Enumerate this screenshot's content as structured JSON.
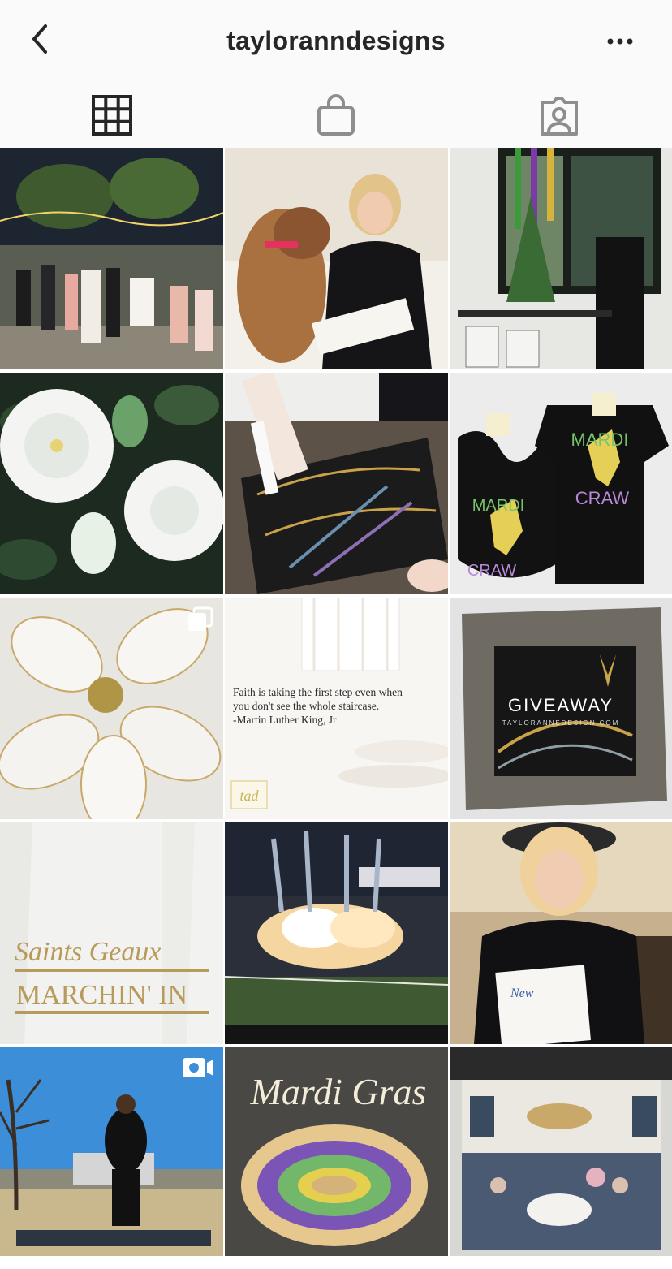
{
  "header": {
    "title": "tayloranndesigns",
    "back_icon": "chevron-left-icon",
    "more_icon": "ellipsis-icon"
  },
  "tabs": [
    {
      "name": "grid",
      "icon": "grid-icon",
      "active": true
    },
    {
      "name": "shop",
      "icon": "shopping-bag-icon",
      "active": false
    },
    {
      "name": "tagged",
      "icon": "tagged-person-icon",
      "active": false
    }
  ],
  "posts": [
    {
      "subject": "wedding painting night courtyard"
    },
    {
      "subject": "woman with boxer dog and book"
    },
    {
      "subject": "shop window with mardi gras beads"
    },
    {
      "subject": "white gardenia painting"
    },
    {
      "subject": "hand painting with gold marker"
    },
    {
      "subject": "mardi craw bib and onesie",
      "text_1": "MARDI",
      "text_2": "CRAW"
    },
    {
      "subject": "white magnolia painting",
      "badge": "carousel-icon"
    },
    {
      "subject": "quote on white spiral staircase",
      "quote_line_1": "Faith is taking the first step even when",
      "quote_line_2": "you don't see the whole staircase.",
      "quote_line_3": "-Martin Luther King, Jr",
      "logo": "tad"
    },
    {
      "subject": "giveaway slate",
      "text_1": "GIVEAWAY",
      "text_2": "TAYLORANNEDESIGN.COM"
    },
    {
      "subject": "saints tea towel",
      "text_1": "Saints Geaux",
      "text_2": "MARCHIN' IN"
    },
    {
      "subject": "stadium pyrotechnics"
    },
    {
      "subject": "woman in hat holding painting"
    },
    {
      "subject": "dancer outdoors video",
      "badge": "video-icon"
    },
    {
      "subject": "mardi gras king cake on slate",
      "text_1": "Mardi Gras"
    },
    {
      "subject": "live event painting ballroom"
    }
  ],
  "colors": {
    "header_bg": "#fafafa",
    "text": "#262626",
    "icon_gray": "#8e8e8e"
  }
}
